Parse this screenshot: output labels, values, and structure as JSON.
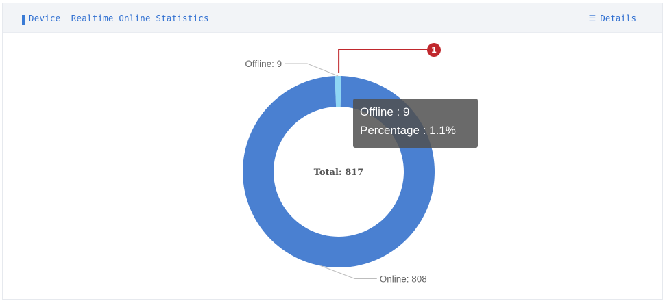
{
  "header": {
    "title": "Device  Realtime Online Statistics",
    "details_label": "Details",
    "details_icon": "list-icon"
  },
  "colors": {
    "online": "#4a80d1",
    "offline": "#8fd6f4",
    "accent": "#3a7bd5",
    "callout": "#c0282d"
  },
  "tooltip": {
    "line1": "Offline : 9",
    "line2": "Percentage : 1.1%"
  },
  "callout": {
    "number": "1"
  },
  "chart_data": {
    "type": "pie",
    "donut": true,
    "center_label": "Total: 817",
    "total": 817,
    "slices": [
      {
        "name": "Offline",
        "value": 9,
        "label": "Offline: 9",
        "percentage": "1.1%"
      },
      {
        "name": "Online",
        "value": 808,
        "label": "Online: 808"
      }
    ]
  }
}
